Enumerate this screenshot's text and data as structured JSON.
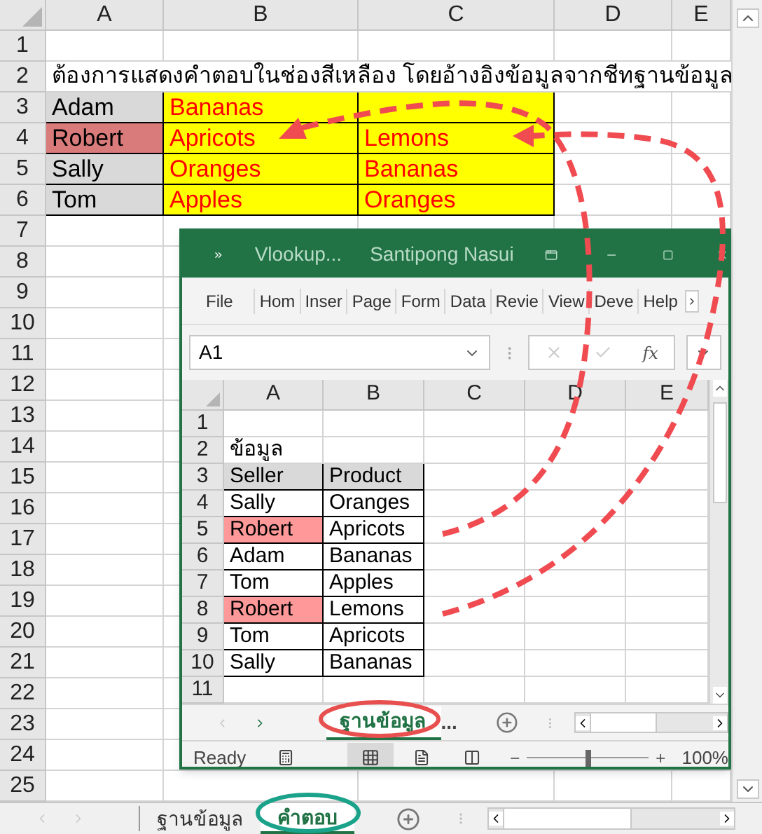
{
  "sheet": {
    "columns": [
      "A",
      "B",
      "C",
      "D",
      "E"
    ],
    "rows": [
      {
        "number": "1",
        "kind": "blank"
      },
      {
        "number": "2",
        "kind": "note",
        "text": "ต้องการแสดงคำตอบในช่องสีเหลือง โดยอ้างอิงข้อมูลจากชีทฐานข้อมูล"
      },
      {
        "number": "3",
        "kind": "record",
        "name": "Adam",
        "highlighted": false,
        "products": [
          "Bananas"
        ]
      },
      {
        "number": "4",
        "kind": "record",
        "name": "Robert",
        "highlighted": true,
        "products": [
          "Apricots",
          "Lemons"
        ]
      },
      {
        "number": "5",
        "kind": "record",
        "name": "Sally",
        "highlighted": false,
        "products": [
          "Oranges",
          "Bananas"
        ]
      },
      {
        "number": "6",
        "kind": "record",
        "name": "Tom",
        "highlighted": false,
        "products": [
          "Apples",
          "Oranges"
        ]
      },
      {
        "number": "7",
        "kind": "blank"
      },
      {
        "number": "8",
        "kind": "blank"
      },
      {
        "number": "9",
        "kind": "blank"
      },
      {
        "number": "10",
        "kind": "blank"
      },
      {
        "number": "11",
        "kind": "blank"
      },
      {
        "number": "12",
        "kind": "blank"
      },
      {
        "number": "13",
        "kind": "blank"
      },
      {
        "number": "14",
        "kind": "blank"
      },
      {
        "number": "15",
        "kind": "blank"
      },
      {
        "number": "16",
        "kind": "blank"
      },
      {
        "number": "17",
        "kind": "blank"
      },
      {
        "number": "18",
        "kind": "blank"
      },
      {
        "number": "19",
        "kind": "blank"
      },
      {
        "number": "20",
        "kind": "blank"
      },
      {
        "number": "21",
        "kind": "blank"
      },
      {
        "number": "22",
        "kind": "blank"
      },
      {
        "number": "23",
        "kind": "blank"
      },
      {
        "number": "24",
        "kind": "blank"
      },
      {
        "number": "25",
        "kind": "blank"
      }
    ]
  },
  "sheet_tabs": [
    {
      "label": "ฐานข้อมูล",
      "selected": false
    },
    {
      "label": "คำตอบ",
      "selected": true
    }
  ],
  "workbook_window": {
    "title": "Vlookup...",
    "user": "Santipong Nasui",
    "ribbon_tabs": [
      "File",
      "Hom",
      "Inser",
      "Page",
      "Form",
      "Data",
      "Revie",
      "View",
      "Deve",
      "Help"
    ],
    "name_box": "A1",
    "function_label": "fx",
    "columns": [
      "A",
      "B",
      "C",
      "D",
      "E"
    ],
    "rows": [
      {
        "number": "1",
        "kind": "blank"
      },
      {
        "number": "2",
        "kind": "note",
        "text": "ข้อมูล"
      },
      {
        "number": "3",
        "kind": "header",
        "cells": [
          "Seller",
          "Product"
        ]
      },
      {
        "number": "4",
        "kind": "record",
        "cells": [
          "Sally",
          "Oranges"
        ],
        "highlighted": false
      },
      {
        "number": "5",
        "kind": "record",
        "cells": [
          "Robert",
          "Apricots"
        ],
        "highlighted": true
      },
      {
        "number": "6",
        "kind": "record",
        "cells": [
          "Adam",
          "Bananas"
        ],
        "highlighted": false
      },
      {
        "number": "7",
        "kind": "record",
        "cells": [
          "Tom",
          "Apples"
        ],
        "highlighted": false
      },
      {
        "number": "8",
        "kind": "record",
        "cells": [
          "Robert",
          "Lemons"
        ],
        "highlighted": true
      },
      {
        "number": "9",
        "kind": "record",
        "cells": [
          "Tom",
          "Apricots"
        ],
        "highlighted": false
      },
      {
        "number": "10",
        "kind": "record",
        "cells": [
          "Sally",
          "Bananas"
        ],
        "highlighted": false
      },
      {
        "number": "11",
        "kind": "blank"
      }
    ],
    "sheet_tabs": [
      {
        "label": "ฐานข้อมูล",
        "selected": true
      }
    ],
    "more_tabs": "...",
    "status": "Ready",
    "zoom": {
      "level": 0.5,
      "reading": "100%"
    }
  }
}
